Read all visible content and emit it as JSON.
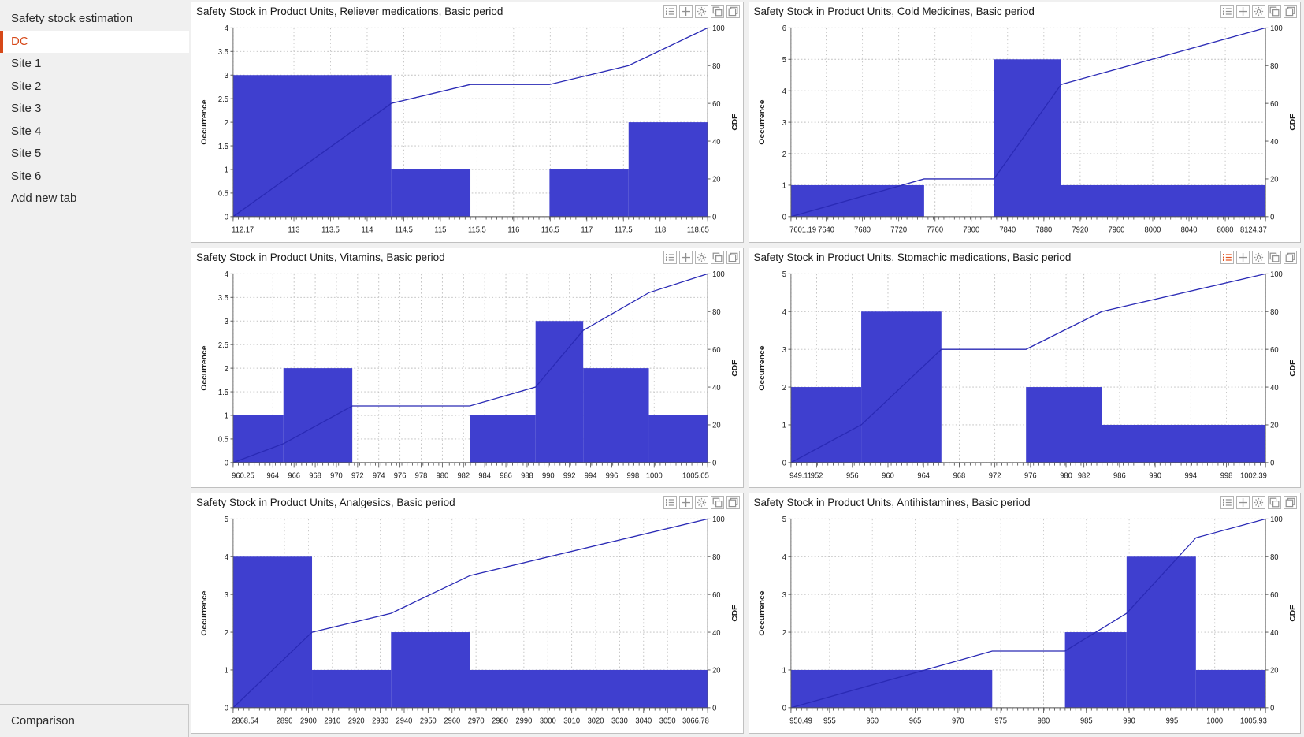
{
  "sidebar": {
    "items": [
      {
        "label": "Safety stock estimation",
        "selected": false
      },
      {
        "label": "DC",
        "selected": true
      },
      {
        "label": "Site 1",
        "selected": false
      },
      {
        "label": "Site 2",
        "selected": false
      },
      {
        "label": "Site 3",
        "selected": false
      },
      {
        "label": "Site 4",
        "selected": false
      },
      {
        "label": "Site 5",
        "selected": false
      },
      {
        "label": "Site 6",
        "selected": false
      },
      {
        "label": "Add new tab",
        "selected": false
      }
    ],
    "footer_label": "Comparison",
    "selected_color": "#d64818"
  },
  "toolbar": {
    "icons": [
      {
        "name": "legend-list-icon",
        "title": "Legend"
      },
      {
        "name": "crosshair-plus-icon",
        "title": "Crosshair"
      },
      {
        "name": "gear-icon",
        "title": "Settings"
      },
      {
        "name": "duplicate-icon",
        "title": "Copy"
      },
      {
        "name": "maximize-window-icon",
        "title": "Maximize"
      }
    ],
    "active_color": "#e2521d",
    "idle_color": "#909090"
  },
  "colors": {
    "bar": "#3f3fcf",
    "cdf": "#2a2ab5",
    "grid": "#bdbdbd",
    "panel_border": "#c0c0c0",
    "background": "#f0f0f0"
  },
  "chart_data": [
    {
      "id": "reliever-medications",
      "type": "bar",
      "title": "Safety Stock in Product Units, Reliever medications, Basic period",
      "ylabel": "Occurrence",
      "y2label": "CDF",
      "xlabel": "",
      "ylim": [
        0,
        4
      ],
      "y2lim": [
        0,
        100
      ],
      "yticks": [
        0,
        0.5,
        1,
        1.5,
        2,
        2.5,
        3,
        3.5,
        4
      ],
      "y2ticks": [
        0,
        20,
        40,
        60,
        80,
        100
      ],
      "xlim": [
        112.17,
        118.65
      ],
      "xticks": [
        112.17,
        113,
        113.5,
        114,
        114.5,
        115,
        115.5,
        116,
        116.5,
        117,
        117.5,
        118,
        118.65
      ],
      "xticklabels": [
        "112.17",
        "113",
        "113.5",
        "114",
        "114.5",
        "115",
        "115.5",
        "116",
        "116.5",
        "117",
        "117.5",
        "118",
        "118.65"
      ],
      "bins": [
        {
          "x0": 112.17,
          "x1": 114.33,
          "value": 3
        },
        {
          "x0": 114.33,
          "x1": 115.41,
          "value": 1
        },
        {
          "x0": 115.41,
          "x1": 116.49,
          "value": 0
        },
        {
          "x0": 116.49,
          "x1": 117.57,
          "value": 1
        },
        {
          "x0": 117.57,
          "x1": 118.65,
          "value": 2
        }
      ],
      "cdf": [
        {
          "x": 112.17,
          "y": 0
        },
        {
          "x": 114.33,
          "y": 60
        },
        {
          "x": 115.41,
          "y": 70
        },
        {
          "x": 116.49,
          "y": 70
        },
        {
          "x": 117.03,
          "y": 75
        },
        {
          "x": 117.57,
          "y": 80
        },
        {
          "x": 118.65,
          "y": 100
        }
      ],
      "toolbar_active_index": -1
    },
    {
      "id": "cold-medicines",
      "type": "bar",
      "title": "Safety Stock in Product Units, Cold Medicines, Basic period",
      "ylabel": "Occurrence",
      "y2label": "CDF",
      "xlabel": "",
      "ylim": [
        0,
        6
      ],
      "y2lim": [
        0,
        100
      ],
      "yticks": [
        0,
        1,
        2,
        3,
        4,
        5,
        6
      ],
      "y2ticks": [
        0,
        20,
        40,
        60,
        80,
        100
      ],
      "xlim": [
        7601.19,
        8124.37
      ],
      "xticks": [
        7601.19,
        7640,
        7680,
        7720,
        7760,
        7800,
        7840,
        7880,
        7920,
        7960,
        8000,
        8040,
        8080,
        8124.37
      ],
      "xticklabels": [
        "7601.19",
        "7640",
        "7680",
        "7720",
        "7760",
        "7800",
        "7840",
        "7880",
        "7920",
        "7960",
        "8000",
        "8040",
        "8080",
        "8124.37"
      ],
      "bins": [
        {
          "x0": 7601.19,
          "x1": 7748.0,
          "value": 1
        },
        {
          "x0": 7748.0,
          "x1": 7825.0,
          "value": 0
        },
        {
          "x0": 7825.0,
          "x1": 7899.0,
          "value": 5
        },
        {
          "x0": 7899.0,
          "x1": 8124.37,
          "value": 1
        }
      ],
      "cdf": [
        {
          "x": 7601.19,
          "y": 0
        },
        {
          "x": 7748.0,
          "y": 20
        },
        {
          "x": 7825.0,
          "y": 20
        },
        {
          "x": 7899.0,
          "y": 70
        },
        {
          "x": 8124.37,
          "y": 100
        }
      ],
      "toolbar_active_index": -1
    },
    {
      "id": "vitamins",
      "type": "bar",
      "title": "Safety Stock in Product Units, Vitamins, Basic period",
      "ylabel": "Occurrence",
      "y2label": "CDF",
      "xlabel": "",
      "ylim": [
        0,
        4
      ],
      "y2lim": [
        0,
        100
      ],
      "yticks": [
        0,
        0.5,
        1,
        1.5,
        2,
        2.5,
        3,
        3.5,
        4
      ],
      "y2ticks": [
        0,
        20,
        40,
        60,
        80,
        100
      ],
      "xlim": [
        960.25,
        1005.05
      ],
      "xticks": [
        960.25,
        964,
        966,
        968,
        970,
        972,
        974,
        976,
        978,
        980,
        982,
        984,
        986,
        988,
        990,
        992,
        994,
        996,
        998,
        1000,
        1005.05
      ],
      "xticklabels": [
        "960.25",
        "964",
        "966",
        "968",
        "970",
        "972",
        "974",
        "976",
        "978",
        "980",
        "982",
        "984",
        "986",
        "988",
        "990",
        "992",
        "994",
        "996",
        "998",
        "1000",
        "1005.05"
      ],
      "bins": [
        {
          "x0": 960.25,
          "x1": 965.0,
          "value": 1
        },
        {
          "x0": 965.0,
          "x1": 971.5,
          "value": 2
        },
        {
          "x0": 971.5,
          "x1": 982.6,
          "value": 0
        },
        {
          "x0": 982.6,
          "x1": 988.8,
          "value": 1
        },
        {
          "x0": 988.8,
          "x1": 993.3,
          "value": 3
        },
        {
          "x0": 993.3,
          "x1": 999.5,
          "value": 2
        },
        {
          "x0": 999.5,
          "x1": 1005.05,
          "value": 1
        }
      ],
      "cdf": [
        {
          "x": 960.25,
          "y": 0
        },
        {
          "x": 965.0,
          "y": 10
        },
        {
          "x": 971.5,
          "y": 30
        },
        {
          "x": 982.6,
          "y": 30
        },
        {
          "x": 988.8,
          "y": 40
        },
        {
          "x": 993.3,
          "y": 70
        },
        {
          "x": 999.5,
          "y": 90
        },
        {
          "x": 1005.05,
          "y": 100
        }
      ],
      "toolbar_active_index": -1
    },
    {
      "id": "stomachic-medications",
      "type": "bar",
      "title": "Safety Stock in Product Units, Stomachic medications, Basic period",
      "ylabel": "Occurrence",
      "y2label": "CDF",
      "xlabel": "",
      "ylim": [
        0,
        5
      ],
      "y2lim": [
        0,
        100
      ],
      "yticks": [
        0,
        1,
        2,
        3,
        4,
        5
      ],
      "y2ticks": [
        0,
        20,
        40,
        60,
        80,
        100
      ],
      "xlim": [
        949.11,
        1002.39
      ],
      "xticks": [
        949.11,
        952,
        956,
        960,
        964,
        968,
        972,
        976,
        980,
        982,
        986,
        990,
        994,
        998,
        1002.39
      ],
      "xticklabels": [
        "949.11",
        "952",
        "956",
        "960",
        "964",
        "968",
        "972",
        "976",
        "980",
        "982",
        "986",
        "990",
        "994",
        "998",
        "1002.39"
      ],
      "bins": [
        {
          "x0": 949.11,
          "x1": 957.0,
          "value": 2
        },
        {
          "x0": 957.0,
          "x1": 966.0,
          "value": 4
        },
        {
          "x0": 966.0,
          "x1": 975.5,
          "value": 0
        },
        {
          "x0": 975.5,
          "x1": 984.0,
          "value": 2
        },
        {
          "x0": 984.0,
          "x1": 1002.39,
          "value": 1
        }
      ],
      "cdf": [
        {
          "x": 949.11,
          "y": 0
        },
        {
          "x": 957.0,
          "y": 20
        },
        {
          "x": 966.0,
          "y": 60
        },
        {
          "x": 975.5,
          "y": 60
        },
        {
          "x": 984.0,
          "y": 80
        },
        {
          "x": 1002.39,
          "y": 100
        }
      ],
      "toolbar_active_index": 0
    },
    {
      "id": "analgesics",
      "type": "bar",
      "title": "Safety Stock in Product Units, Analgesics, Basic period",
      "ylabel": "Occurrence",
      "y2label": "CDF",
      "xlabel": "",
      "ylim": [
        0,
        5
      ],
      "y2lim": [
        0,
        100
      ],
      "yticks": [
        0,
        1,
        2,
        3,
        4,
        5
      ],
      "y2ticks": [
        0,
        20,
        40,
        60,
        80,
        100
      ],
      "xlim": [
        2868.54,
        3066.78
      ],
      "xticks": [
        2868.54,
        2890,
        2900,
        2910,
        2920,
        2930,
        2940,
        2950,
        2960,
        2970,
        2980,
        2990,
        3000,
        3010,
        3020,
        3030,
        3040,
        3050,
        3066.78
      ],
      "xticklabels": [
        "2868.54",
        "2890",
        "2900",
        "2910",
        "2920",
        "2930",
        "2940",
        "2950",
        "2960",
        "2970",
        "2980",
        "2990",
        "3000",
        "3010",
        "3020",
        "3030",
        "3040",
        "3050",
        "3066.78"
      ],
      "bins": [
        {
          "x0": 2868.54,
          "x1": 2901.5,
          "value": 4
        },
        {
          "x0": 2901.5,
          "x1": 2934.5,
          "value": 1
        },
        {
          "x0": 2934.5,
          "x1": 2967.5,
          "value": 2
        },
        {
          "x0": 2967.5,
          "x1": 3066.78,
          "value": 1
        }
      ],
      "cdf": [
        {
          "x": 2868.54,
          "y": 0
        },
        {
          "x": 2901.5,
          "y": 40
        },
        {
          "x": 2934.5,
          "y": 50
        },
        {
          "x": 2967.5,
          "y": 70
        },
        {
          "x": 3066.78,
          "y": 100
        }
      ],
      "toolbar_active_index": -1
    },
    {
      "id": "antihistamines",
      "type": "bar",
      "title": "Safety Stock in Product Units, Antihistamines, Basic period",
      "ylabel": "Occurrence",
      "y2label": "CDF",
      "xlabel": "",
      "ylim": [
        0,
        5
      ],
      "y2lim": [
        0,
        100
      ],
      "yticks": [
        0,
        1,
        2,
        3,
        4,
        5
      ],
      "y2ticks": [
        0,
        20,
        40,
        60,
        80,
        100
      ],
      "xlim": [
        950.49,
        1005.93
      ],
      "xticks": [
        950.49,
        955,
        960,
        965,
        970,
        975,
        980,
        985,
        990,
        995,
        1000,
        1005.93
      ],
      "xticklabels": [
        "950.49",
        "955",
        "960",
        "965",
        "970",
        "975",
        "980",
        "985",
        "990",
        "995",
        "1000",
        "1005.93"
      ],
      "bins": [
        {
          "x0": 950.49,
          "x1": 974.0,
          "value": 1
        },
        {
          "x0": 974.0,
          "x1": 982.5,
          "value": 0
        },
        {
          "x0": 982.5,
          "x1": 989.7,
          "value": 2
        },
        {
          "x0": 989.7,
          "x1": 997.8,
          "value": 4
        },
        {
          "x0": 997.8,
          "x1": 1005.93,
          "value": 1
        }
      ],
      "cdf": [
        {
          "x": 950.49,
          "y": 0
        },
        {
          "x": 974.0,
          "y": 30
        },
        {
          "x": 982.5,
          "y": 30
        },
        {
          "x": 989.7,
          "y": 50
        },
        {
          "x": 997.8,
          "y": 90
        },
        {
          "x": 1005.93,
          "y": 100
        }
      ],
      "toolbar_active_index": -1
    }
  ]
}
